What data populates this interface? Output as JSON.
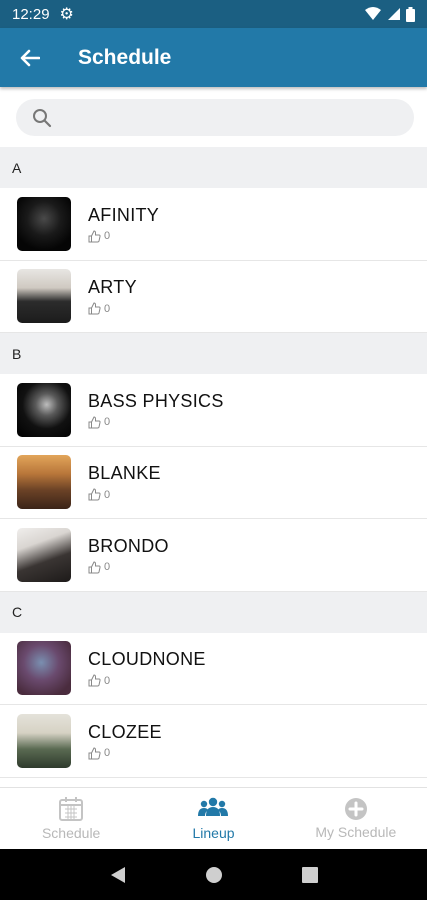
{
  "status_bar": {
    "time": "12:29"
  },
  "header": {
    "title": "Schedule"
  },
  "search": {
    "placeholder": "",
    "value": ""
  },
  "sections": [
    {
      "letter": "A",
      "artists": [
        {
          "name": "AFINITY",
          "likes": "0"
        },
        {
          "name": "ARTY",
          "likes": "0"
        }
      ]
    },
    {
      "letter": "B",
      "artists": [
        {
          "name": "BASS PHYSICS",
          "likes": "0"
        },
        {
          "name": "BLANKE",
          "likes": "0"
        },
        {
          "name": "BRONDO",
          "likes": "0"
        }
      ]
    },
    {
      "letter": "C",
      "artists": [
        {
          "name": "CLOUDNONE",
          "likes": "0"
        },
        {
          "name": "CLOZEE",
          "likes": "0"
        }
      ]
    }
  ],
  "bottom_nav": [
    {
      "label": "Schedule",
      "icon": "calendar-icon",
      "active": false
    },
    {
      "label": "Lineup",
      "icon": "people-icon",
      "active": true
    },
    {
      "label": "My Schedule",
      "icon": "plus-circle-icon",
      "active": false
    }
  ],
  "colors": {
    "primary": "#2279a8",
    "status_bar": "#1b5f82",
    "inactive": "#b8b8b8"
  }
}
